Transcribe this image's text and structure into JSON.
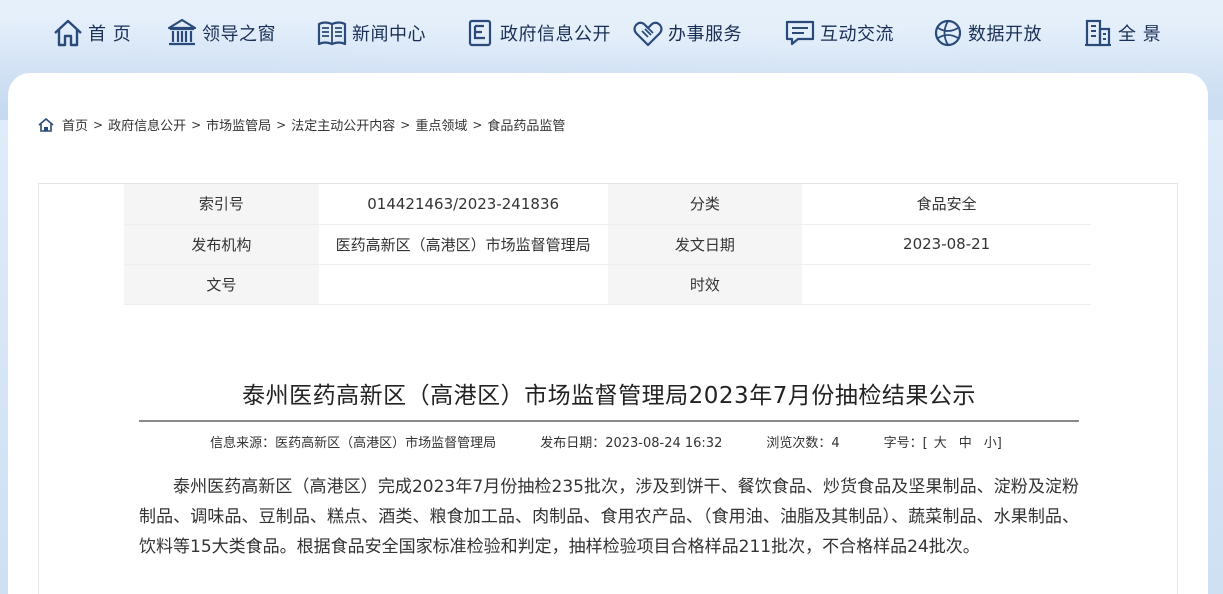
{
  "nav": {
    "items": [
      {
        "label": "首 页",
        "icon": "home-icon"
      },
      {
        "label": "领导之窗",
        "icon": "building-icon"
      },
      {
        "label": "新闻中心",
        "icon": "book-icon"
      },
      {
        "label": "政府信息公开",
        "icon": "document-icon"
      },
      {
        "label": "办事服务",
        "icon": "handshake-icon"
      },
      {
        "label": "互动交流",
        "icon": "chat-icon"
      },
      {
        "label": "数据开放",
        "icon": "globe-icon"
      },
      {
        "label": "全 景",
        "icon": "city-icon"
      }
    ]
  },
  "breadcrumb": [
    "首页",
    "政府信息公开",
    "市场监管局",
    "法定主动公开内容",
    "重点领域",
    "食品药品监管"
  ],
  "meta": {
    "index_label": "索引号",
    "index_value": "014421463/2023-241836",
    "category_label": "分类",
    "category_value": "食品安全",
    "publisher_label": "发布机构",
    "publisher_value": "医药高新区（高港区）市场监督管理局",
    "date_label": "发文日期",
    "date_value": "2023-08-21",
    "docno_label": "文号",
    "docno_value": "",
    "validity_label": "时效",
    "validity_value": ""
  },
  "article": {
    "title": "泰州医药高新区（高港区）市场监督管理局2023年7月份抽检结果公示",
    "source": "信息来源：医药高新区（高港区）市场监督管理局",
    "published": "发布日期：2023-08-24 16:32",
    "views": "浏览次数：4",
    "font_size_label": "字号：[",
    "font_large": "大",
    "font_medium": "中",
    "font_small": "小]",
    "body": "泰州医药高新区（高港区）完成2023年7月份抽检235批次，涉及到饼干、餐饮食品、炒货食品及坚果制品、淀粉及淀粉制品、调味品、豆制品、糕点、酒类、粮食加工品、肉制品、食用农产品、（食用油、油脂及其制品）、蔬菜制品、水果制品、饮料等15大类食品。根据食品安全国家标准检验和判定，抽样检验项目合格样品211批次，不合格样品24批次。"
  },
  "colors": {
    "nav_text": "#1a2f55",
    "icon": "#2a4a7a"
  }
}
